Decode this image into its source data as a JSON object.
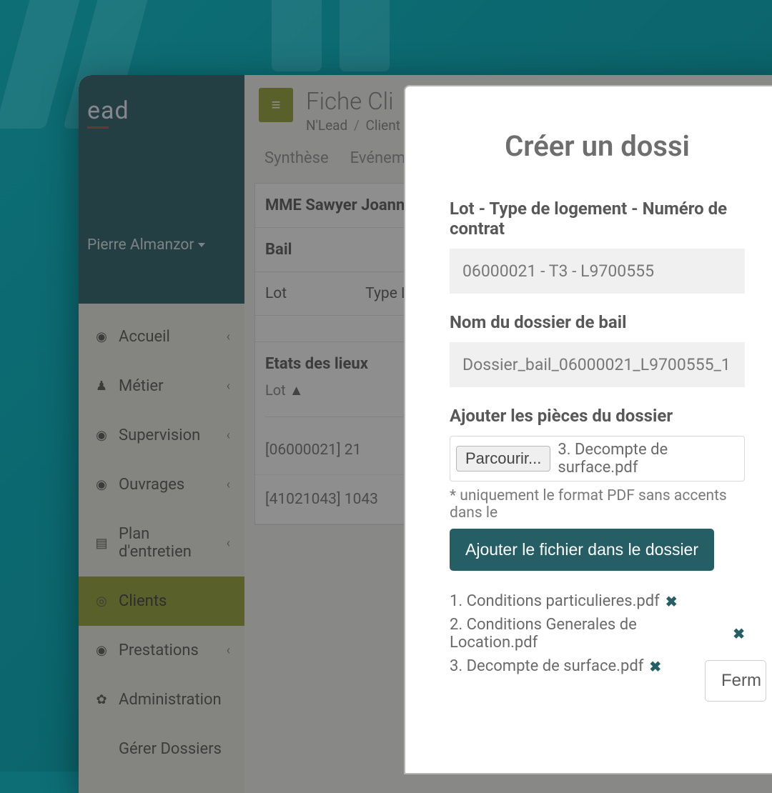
{
  "colors": {
    "accent": "#8a9a1f",
    "teal_dark": "#265e66",
    "bg_teal": "#0d6e76"
  },
  "logo": {
    "text": "ead"
  },
  "user": {
    "name": "Pierre Almanzor"
  },
  "sidebar": {
    "items": [
      {
        "label": "Accueil",
        "icon": "eye",
        "has_children": true,
        "active": false
      },
      {
        "label": "Métier",
        "icon": "person",
        "has_children": true,
        "active": false
      },
      {
        "label": "Supervision",
        "icon": "eye",
        "has_children": true,
        "active": false
      },
      {
        "label": "Ouvrages",
        "icon": "eye",
        "has_children": true,
        "active": false
      },
      {
        "label": "Plan d'entretien",
        "icon": "calendar",
        "has_children": true,
        "active": false
      },
      {
        "label": "Clients",
        "icon": "target",
        "has_children": false,
        "active": true
      },
      {
        "label": "Prestations",
        "icon": "eye",
        "has_children": true,
        "active": false
      },
      {
        "label": "Administration",
        "icon": "gear",
        "has_children": false,
        "active": false
      },
      {
        "label": "Gérer Dossiers",
        "icon": "",
        "has_children": false,
        "active": false
      }
    ]
  },
  "header": {
    "title": "Fiche Cli",
    "breadcrumb_root": "N'Lead",
    "breadcrumb_current": "Client"
  },
  "tabs": [
    {
      "label": "Synthèse"
    },
    {
      "label": "Evéneme"
    }
  ],
  "client_panel": {
    "name": "MME Sawyer Joanne",
    "bail_label": "Bail",
    "columns": [
      "Lot",
      "Type L"
    ]
  },
  "etats": {
    "title": "Etats des lieux",
    "sort_col": "Lot",
    "sort_dir": "▲",
    "rows": [
      "[06000021] 21",
      "[41021043] 1043"
    ]
  },
  "modal": {
    "title": "Créer un dossi",
    "lot_label": "Lot - Type de logement - Numéro de contrat",
    "lot_value": "06000021 - T3 - L9700555",
    "dossier_label": "Nom du dossier de bail",
    "dossier_value": "Dossier_bail_06000021_L9700555_1",
    "pieces_label": "Ajouter les pièces du dossier",
    "browse_label": "Parcourir...",
    "selected_file": "3. Decompte de surface.pdf",
    "hint": "* uniquement le format PDF sans accents dans le",
    "add_button": "Ajouter le fichier dans le dossier",
    "files": [
      "1. Conditions particulieres.pdf",
      "2. Conditions Generales de Location.pdf",
      "3. Decompte de surface.pdf"
    ],
    "close_label": "Ferm"
  }
}
